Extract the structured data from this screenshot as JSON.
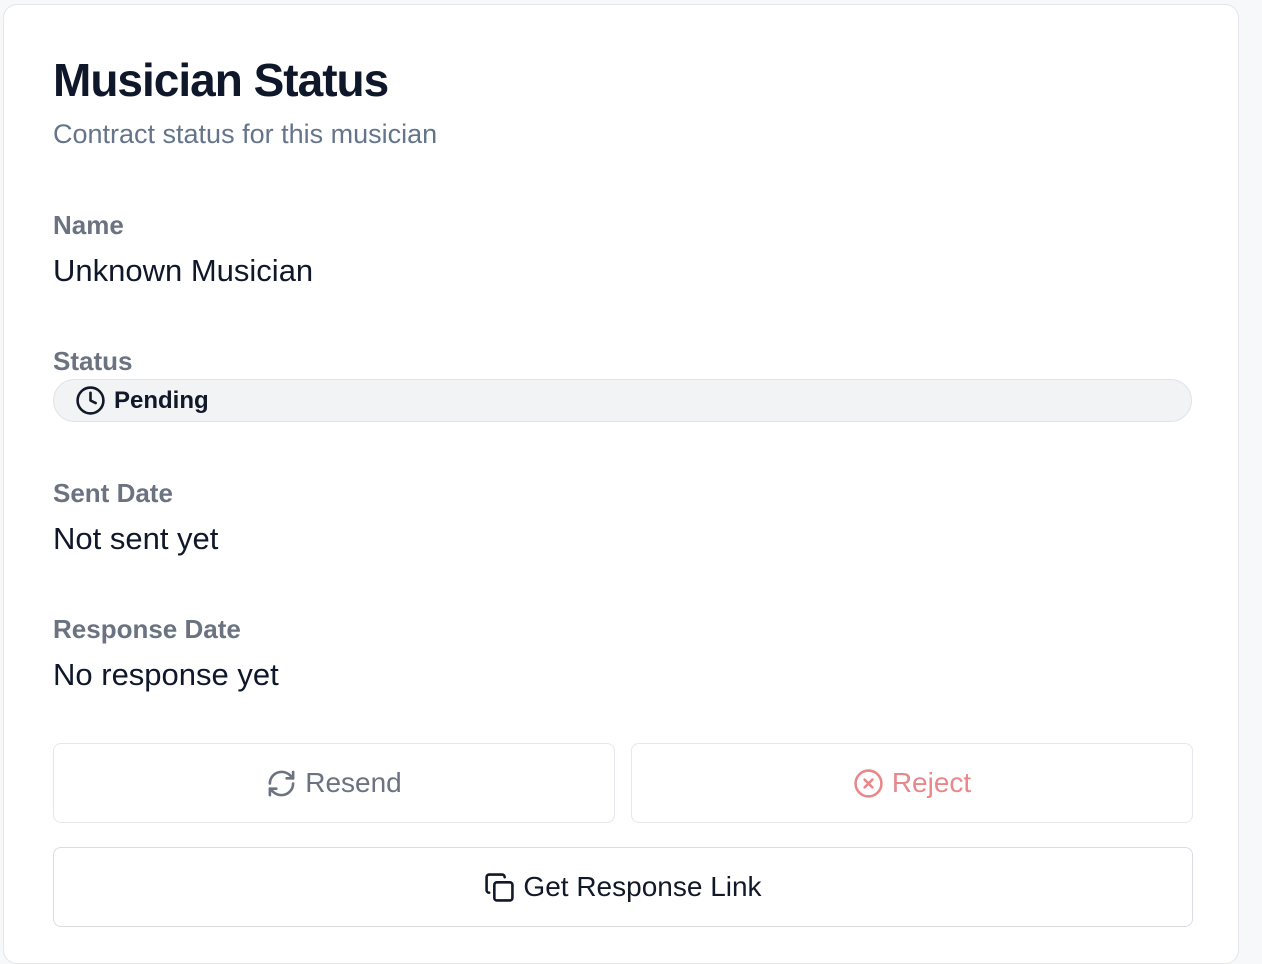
{
  "card": {
    "title": "Musician Status",
    "subtitle": "Contract status for this musician"
  },
  "fields": {
    "name": {
      "label": "Name",
      "value": "Unknown Musician"
    },
    "status": {
      "label": "Status",
      "value": "Pending",
      "icon": "clock-icon"
    },
    "sent_date": {
      "label": "Sent Date",
      "value": "Not sent yet"
    },
    "response_date": {
      "label": "Response Date",
      "value": "No response yet"
    }
  },
  "actions": {
    "resend": {
      "label": "Resend",
      "icon": "refresh-icon",
      "disabled": true
    },
    "reject": {
      "label": "Reject",
      "icon": "x-circle-icon",
      "disabled": true
    },
    "get_link": {
      "label": "Get Response Link",
      "icon": "copy-icon"
    }
  },
  "colors": {
    "title": "#0f172a",
    "muted": "#6b7280",
    "danger_muted": "#e8888a",
    "pill_bg": "#f1f3f5"
  }
}
